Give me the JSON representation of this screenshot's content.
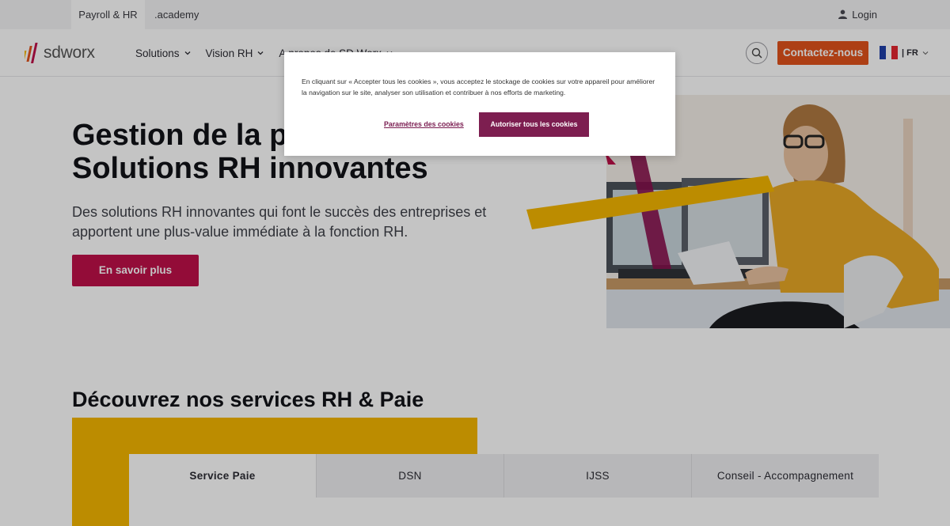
{
  "topbar": {
    "tabs": [
      {
        "label": "Payroll & HR"
      },
      {
        "label": ".academy"
      }
    ],
    "login_label": "Login"
  },
  "nav": {
    "logo_text": "sdworx",
    "menu": [
      {
        "label": "Solutions"
      },
      {
        "label": "Vision RH"
      },
      {
        "label": "A propos de SD Worx"
      }
    ],
    "contact_label": "Contactez-nous",
    "lang_label": "| FR"
  },
  "hero": {
    "title_line1": "Gestion de la paie & RH :",
    "title_line2": "Solutions RH innovantes",
    "subtitle": "Des solutions RH innovantes qui font le succès des entreprises et apportent une plus-value immédiate à la fonction RH.",
    "cta_label": "En savoir plus"
  },
  "services": {
    "title": "Découvrez nos services RH & Paie",
    "tabs": [
      {
        "label": "Service Paie"
      },
      {
        "label": "DSN"
      },
      {
        "label": "IJSS"
      },
      {
        "label": "Conseil - Accompagnement"
      }
    ]
  },
  "cookie_banner": {
    "text": "En cliquant sur « Accepter tous les cookies », vous acceptez le stockage de cookies sur votre appareil pour améliorer la navigation sur le site, analyser son utilisation et contribuer à nos efforts de marketing.",
    "settings_label": "Paramètres des cookies",
    "accept_label": "Autoriser tous les cookies"
  },
  "colors": {
    "brand_red": "#c0104a",
    "contact_orange": "#e2531c",
    "accent_yellow": "#f5b700",
    "cookie_button": "#7d1e50"
  }
}
